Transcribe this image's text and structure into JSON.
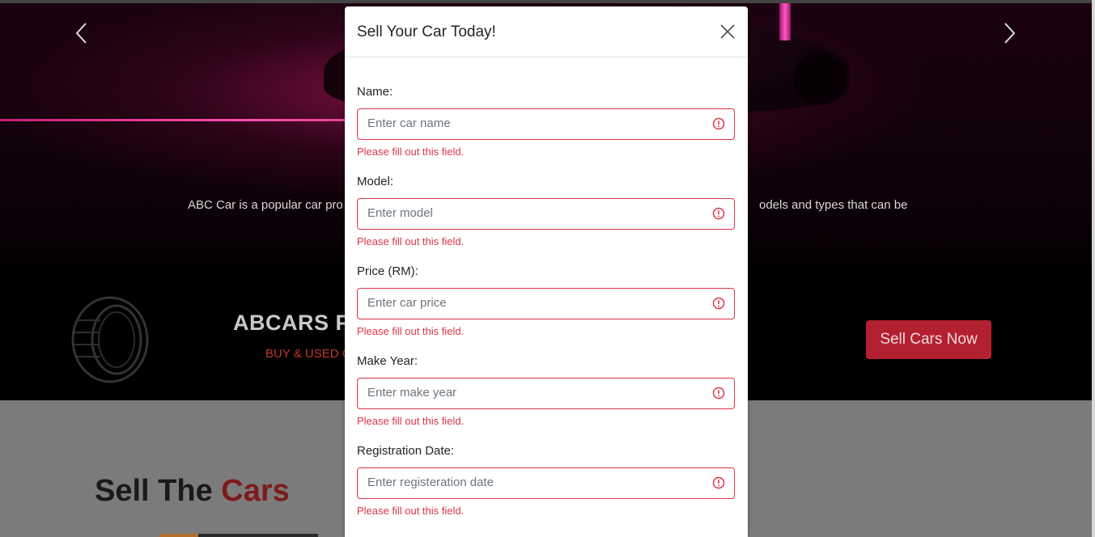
{
  "hero": {
    "prev_arrow": "‹",
    "next_arrow": "›",
    "tagline_left": "ABC Car is a popular car pro",
    "tagline_right": "odels and types that can be",
    "brand_title": "ABCARS PO",
    "brand_sub": "BUY & USED C",
    "sell_button": "Sell Cars Now"
  },
  "section": {
    "title_main": "Sell The ",
    "title_accent": "Cars"
  },
  "modal": {
    "title": "Sell Your Car Today!",
    "fields": [
      {
        "label": "Name:",
        "placeholder": "Enter car name",
        "value": "",
        "error": "Please fill out this field."
      },
      {
        "label": "Model:",
        "placeholder": "Enter model",
        "value": "",
        "error": "Please fill out this field."
      },
      {
        "label": "Price (RM):",
        "placeholder": "Enter car price",
        "value": "",
        "error": "Please fill out this field."
      },
      {
        "label": "Make Year:",
        "placeholder": "Enter make year",
        "value": "",
        "error": "Please fill out this field."
      },
      {
        "label": "Registration Date:",
        "placeholder": "Enter registeration date",
        "value": "",
        "error": "Please fill out this field."
      }
    ]
  },
  "colors": {
    "error": "#dc3545",
    "button": "#b3202f",
    "accent_text": "#7e1a1a"
  },
  "icons": {
    "close": "close-icon",
    "warning": "exclamation-circle-icon",
    "tire": "tire-icon",
    "prev": "chevron-left-icon",
    "next": "chevron-right-icon"
  }
}
